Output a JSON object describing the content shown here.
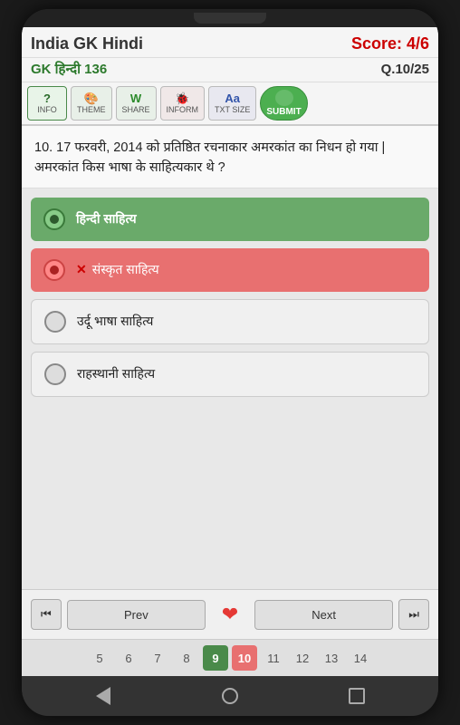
{
  "app": {
    "title": "India GK Hindi",
    "score_label": "Score: 4/6",
    "gk_label": "GK हिन्दी 136",
    "question_num": "Q.10/25"
  },
  "toolbar": {
    "info_label": "INFO",
    "theme_label": "THEME",
    "share_label": "SHARE",
    "inform_label": "INFORM",
    "txtsize_label": "TXT SIZE",
    "submit_label": "SUBMIT"
  },
  "question": {
    "text": "10. 17 फरवरी, 2014 को प्रतिष्ठित रचनाकार अमरकांत का निधन हो गया | अमरकांत किस भाषा के साहित्यकार थे ?"
  },
  "options": [
    {
      "id": 1,
      "text": "हिन्दी साहित्य",
      "state": "correct"
    },
    {
      "id": 2,
      "text": "संस्कृत साहित्य",
      "state": "wrong"
    },
    {
      "id": 3,
      "text": "उर्दू भाषा साहित्य",
      "state": "normal"
    },
    {
      "id": 4,
      "text": "राहस्थानी साहित्य",
      "state": "normal"
    }
  ],
  "navigation": {
    "prev_label": "Prev",
    "next_label": "Next"
  },
  "page_numbers": [
    {
      "num": "5",
      "state": "normal"
    },
    {
      "num": "6",
      "state": "normal"
    },
    {
      "num": "7",
      "state": "normal"
    },
    {
      "num": "8",
      "state": "normal"
    },
    {
      "num": "9",
      "state": "active_correct"
    },
    {
      "num": "10",
      "state": "active_wrong"
    },
    {
      "num": "11",
      "state": "normal"
    },
    {
      "num": "12",
      "state": "normal"
    },
    {
      "num": "13",
      "state": "normal"
    },
    {
      "num": "14",
      "state": "normal"
    }
  ]
}
